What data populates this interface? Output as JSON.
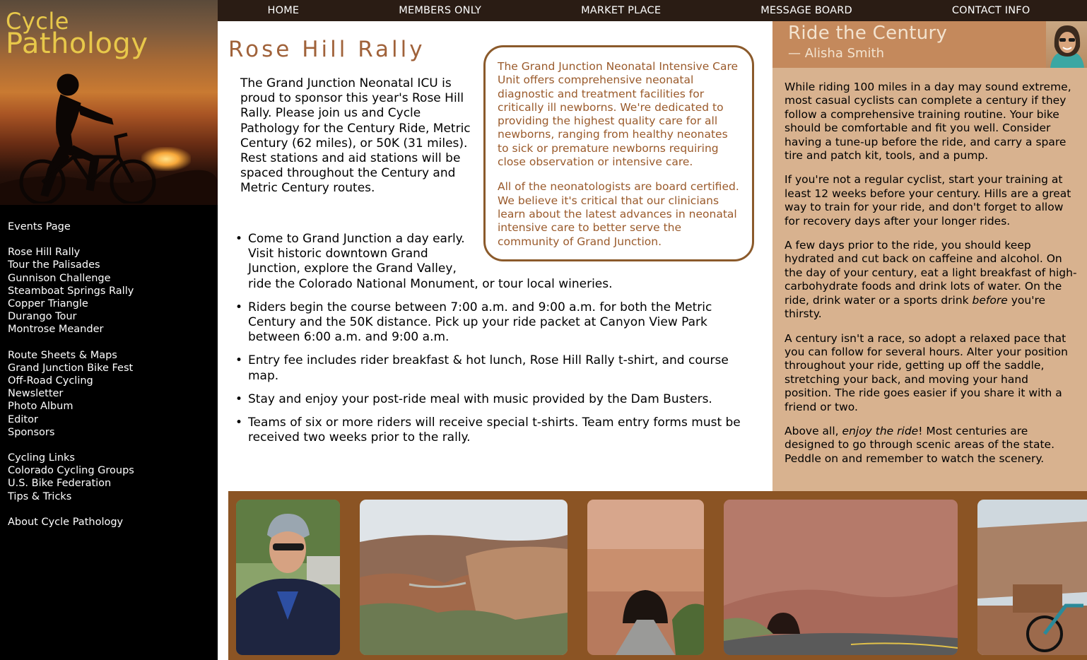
{
  "logo": {
    "line1": "Cycle",
    "line2": "Pathology"
  },
  "topnav": [
    "HOME",
    "MEMBERS ONLY",
    "MARKET PLACE",
    "MESSAGE BOARD",
    "CONTACT INFO"
  ],
  "sidenav": {
    "groups": [
      [
        "Events Page"
      ],
      [
        "Rose Hill Rally",
        "Tour the Palisades",
        "Gunnison Challenge",
        "Steamboat Springs Rally",
        "Copper Triangle",
        "Durango Tour",
        "Montrose Meander"
      ],
      [
        "Route Sheets & Maps",
        "Grand Junction Bike Fest",
        "Off-Road Cycling",
        "Newsletter",
        "Photo Album",
        "Editor",
        "Sponsors"
      ],
      [
        "Cycling Links",
        "Colorado Cycling Groups",
        "U.S. Bike Federation",
        "Tips & Tricks"
      ],
      [
        "About Cycle Pathology"
      ]
    ]
  },
  "main": {
    "title": "Rose Hill Rally",
    "intro": "The Grand Junction Neonatal ICU is proud to sponsor this year's Rose Hill Rally. Please join us and Cycle Pathology for the Century Ride, Metric Century (62 miles), or 50K (31 miles). Rest stations and aid stations will be spaced throughout the Century and Metric Century routes.",
    "infobox": [
      "The Grand Junction Neonatal Intensive Care Unit offers comprehensive neonatal diagnostic and treatment facilities for critically ill newborns. We're dedicated to providing the highest quality care for all newborns, ranging from healthy neonates to sick or premature newborns requiring close observation or intensive care.",
      "All of the neonatologists are board certified. We believe it's critical that our clinicians learn about the latest advances in neonatal intensive care to better serve the community of Grand Junction."
    ],
    "bullets": {
      "b1_part1": "Come to Grand Junction a day early. Visit historic downtown Grand Junction, explore the Grand Valley,",
      "b1_part2": "ride the Colorado National Monument, or tour local wineries.",
      "b2": "Riders begin the course between 7:00 a.m. and 9:00 a.m. for both the Metric Century and the 50K distance. Pick up your ride packet at Canyon View Park between 6:00 a.m. and 9:00 a.m.",
      "b3": "Entry fee includes rider breakfast & hot lunch, Rose Hill Rally t-shirt, and course map.",
      "b4": "Stay and enjoy your post-ride meal with music provided by the Dam Busters.",
      "b5": "Teams of six or more riders will receive special t-shirts. Team entry forms must be received two weeks prior to the rally."
    }
  },
  "sidebar_article": {
    "title": "Ride the Century",
    "author": "— Alisha Smith",
    "p1": "While riding 100 miles in a day may sound extreme, most casual cyclists can complete a century if they follow a comprehensive training routine. Your bike should be comfortable and fit you well. Consider having a tune-up before the ride, and carry a spare tire and patch kit, tools, and a pump.",
    "p2": "If you're not a regular cyclist, start your training at least 12 weeks before your century. Hills are a great way to train for your ride, and don't forget to allow for recovery days after your longer rides.",
    "p3_a": "A few days prior to the ride, you should keep hydrated and cut back on caffeine and alcohol. On the day of your century, eat a light breakfast of high-carbohydrate foods and drink lots of water. On the ride, drink water or a sports drink ",
    "p3_em": "before",
    "p3_b": " you're thirsty.",
    "p4": "A century isn't a race, so adopt a relaxed pace that you can follow for several hours. Alter your position throughout your ride, getting up off the saddle, stretching your back, and moving your hand position. The ride goes easier if you share it with a friend or two.",
    "p5_a": "Above all, ",
    "p5_em": "enjoy the ride",
    "p5_b": "! Most centuries are designed to go through scenic areas of the state. Peddle on and remember to watch the scenery."
  },
  "colors": {
    "topnav_bg": "#2a1c14",
    "title": "#a0623a",
    "infobox_border": "#8b5a2b",
    "sidebar_bg": "#d8b28f",
    "sidebar_header": "#c4895c",
    "photostrip_bg": "#8b5424",
    "logo": "#e8c84a"
  }
}
